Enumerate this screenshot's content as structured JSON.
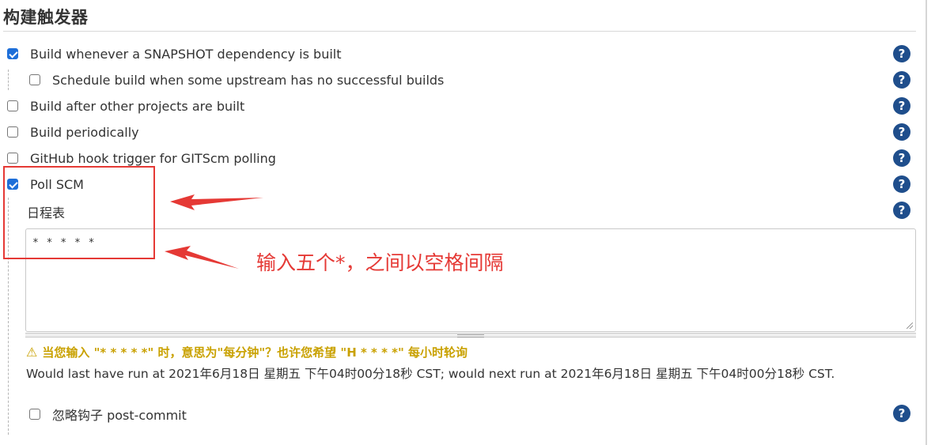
{
  "section": {
    "title": "构建触发器"
  },
  "triggers": [
    {
      "label": "Build whenever a SNAPSHOT dependency is built",
      "checked": true
    },
    {
      "label": "Schedule build when some upstream has no successful builds",
      "checked": false
    },
    {
      "label": "Build after other projects are built",
      "checked": false
    },
    {
      "label": "Build periodically",
      "checked": false
    },
    {
      "label": "GitHub hook trigger for GITScm polling",
      "checked": false
    },
    {
      "label": "Poll SCM",
      "checked": true
    }
  ],
  "poll_scm": {
    "schedule_label": "日程表",
    "schedule_value": "* * * * *",
    "warning_text": "当您输入 \"* * * * *\" 时，意思为\"每分钟\"？也许您希望 \"H * * * *\" 每小时轮询",
    "run_info": "Would last have run at 2021年6月18日 星期五 下午04时00分18秒 CST; would next run at 2021年6月18日 星期五 下午04时00分18秒 CST.",
    "ignore_hooks_label": "忽略钩子 post-commit",
    "ignore_hooks_checked": false
  },
  "help": {
    "glyph": "?"
  },
  "annotation": {
    "text": "输入五个*，之间以空格间隔"
  },
  "colors": {
    "accent": "#1e6fd9",
    "help_bg": "#1f4e8c",
    "warning": "#c9a100",
    "annotation": "#e53935"
  },
  "icons": {
    "help": "help-circle-icon",
    "warning": "warning-triangle-icon",
    "check": "checkbox-icon"
  }
}
